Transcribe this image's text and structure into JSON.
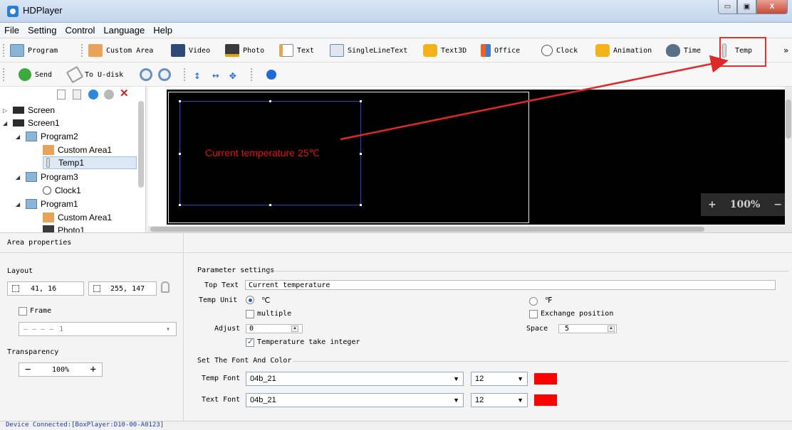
{
  "window": {
    "title": "HDPlayer",
    "minimize": "▭",
    "maximize": "▣",
    "close": "X"
  },
  "menu": [
    "File",
    "Setting",
    "Control",
    "Language",
    "Help"
  ],
  "toolbar1": {
    "program": "Program",
    "custom_area": "Custom Area",
    "video": "Video",
    "photo": "Photo",
    "text": "Text",
    "single_line_text": "SingleLineText",
    "text3d": "Text3D",
    "office": "Office",
    "clock": "Clock",
    "animation": "Animation",
    "time": "Time",
    "temp": "Temp",
    "more": "»"
  },
  "toolbar2": {
    "send": "Send",
    "to_udisk": "To U-disk"
  },
  "tree": {
    "items": [
      {
        "label": "Screen"
      },
      {
        "label": "Screen1"
      },
      {
        "label": "Program2"
      },
      {
        "label": "Custom Area1"
      },
      {
        "label": "Temp1"
      },
      {
        "label": "Program3"
      },
      {
        "label": "Clock1"
      },
      {
        "label": "Program1"
      },
      {
        "label": "Custom Area1"
      },
      {
        "label": "Photo1"
      }
    ]
  },
  "canvas": {
    "temp_text": "Current temperature 25℃",
    "zoom_minus": "−",
    "zoom_plus": "+",
    "zoom_value": "100%"
  },
  "area_properties": {
    "title": "Area properties",
    "layout_label": "Layout",
    "position": "41, 16",
    "size": "255, 147",
    "frame_label": "Frame",
    "frame_value": "1",
    "transparency_label": "Transparency",
    "transparency_value": "100%",
    "minus": "−",
    "plus": "+"
  },
  "parameters": {
    "section_title": "Parameter settings",
    "top_text_label": "Top Text",
    "top_text_value": "Current temperature",
    "temp_unit_label": "Temp Unit",
    "unit_c": "℃",
    "unit_f": "℉",
    "multiple_label": "multiple",
    "exchange_label": "Exchange position",
    "adjust_label": "Adjust",
    "adjust_value": "0",
    "space_label": "Space",
    "space_value": "5",
    "integer_label": "Temperature take integer",
    "font_section_title": "Set The Font And Color",
    "temp_font_label": "Temp Font",
    "temp_font_value": "04b_21",
    "temp_font_size": "12",
    "text_font_label": "Text Font",
    "text_font_value": "04b_21",
    "text_font_size": "12",
    "font_color": "#ff0000"
  },
  "status": {
    "text": "Device Connected:[BoxPlayer:D10-00-A0123]"
  }
}
